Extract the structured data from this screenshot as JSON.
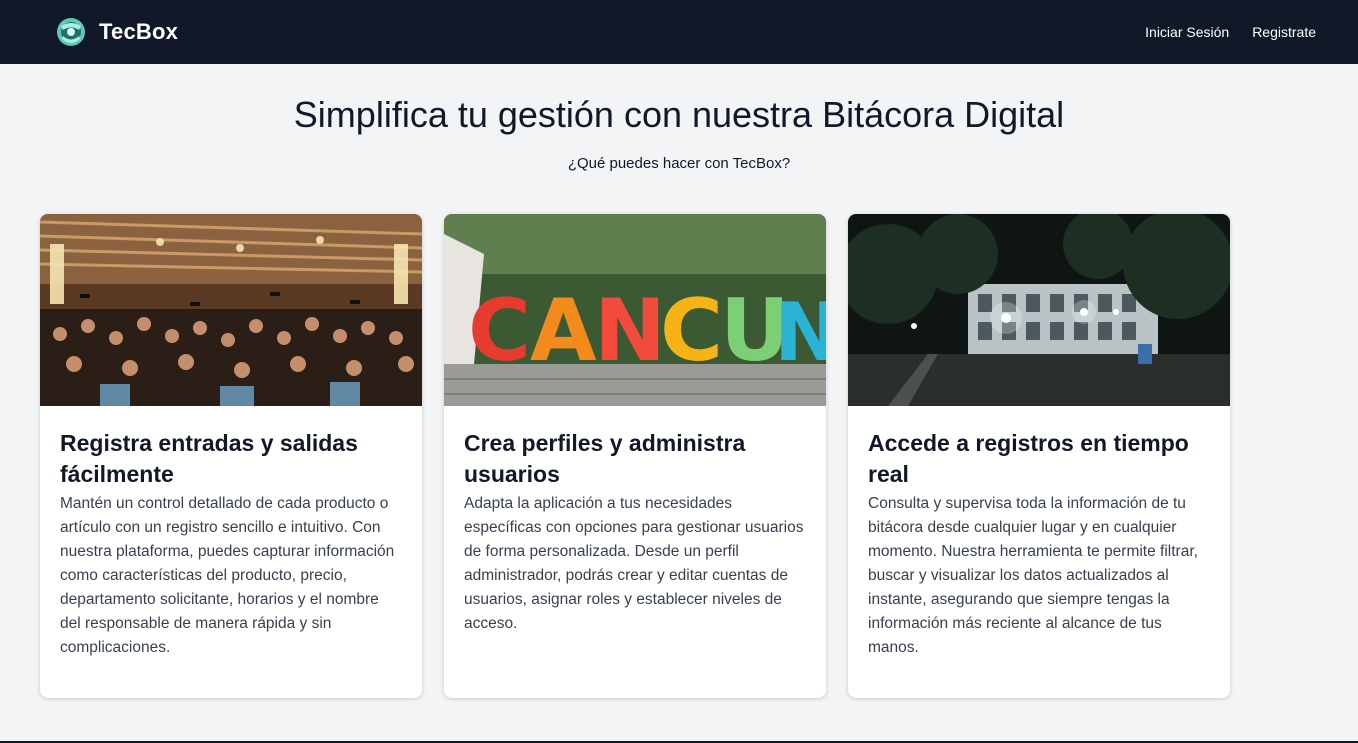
{
  "nav": {
    "brand": "TecBox",
    "links": [
      "Iniciar Sesión",
      "Registrate"
    ]
  },
  "hero": {
    "title": "Simplifica tu gestión con nuestra Bitácora Digital",
    "subtitle": "¿Qué puedes hacer con TecBox?"
  },
  "cards": [
    {
      "title": "Registra entradas y salidas fácilmente",
      "text": "Mantén un control detallado de cada producto o artículo con un registro sencillo e intuitivo. Con nuestra plataforma, puedes capturar información como características del producto, precio, departamento solicitante, horarios y el nombre del responsable de manera rápida y sin complicaciones.",
      "image": "graduation-photo"
    },
    {
      "title": "Crea perfiles y administra usuarios",
      "text": "Adapta la aplicación a tus necesidades específicas con opciones para gestionar usuarios de forma personalizada. Desde un perfil administrador, podrás crear y editar cuentas de usuarios, asignar roles y establecer niveles de acceso.",
      "image": "cancun-sign-photo",
      "image_letters": "CANCUN"
    },
    {
      "title": "Accede a registros en tiempo real",
      "text": "Consulta y supervisa toda la información de tu bitácora desde cualquier lugar y en cualquier momento. Nuestra herramienta te permite filtrar, buscar y visualizar los datos actualizados al instante, asegurando que siempre tengas la información más reciente al alcance de tus manos.",
      "image": "campus-night-photo"
    }
  ]
}
